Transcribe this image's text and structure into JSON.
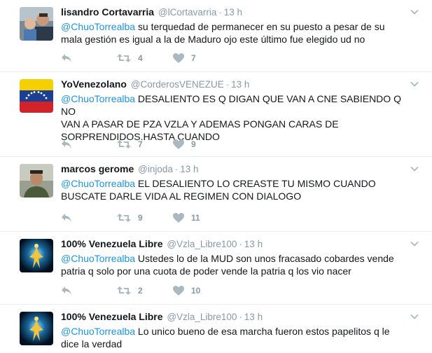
{
  "tweets": [
    {
      "fullname": "lisandro Cortavarria",
      "username": "@lCortavarria",
      "time": "13 h",
      "mention": "@ChuoTorrealba",
      "text": " su terquedad de permanecer en su puesto a pesar de su\nmala gestión es igual a la de Maduro ojo este último fue elegido ud no",
      "retweets": "4",
      "likes": "7",
      "avatar": "man-with-child-photo"
    },
    {
      "fullname": "YoVenezolano",
      "username": "@CorderosVENEZUE",
      "time": "13 h",
      "mention": "@ChuoTorrealba",
      "text": " DESALIENTO ES Q DIGAN QUE VAN A CNE SABIENDO Q NO\nVAN A PASAR DE PZA VZLA Y ADEMAS PONGAN CARAS DE\nSORPRENDIDOS.HASTA CUANDO",
      "retweets": "7",
      "likes": "9",
      "avatar": "venezuela-flag"
    },
    {
      "fullname": "marcos gerome",
      "username": "@injoda",
      "time": "13 h",
      "mention": "@ChuoTorrealba",
      "text": " EL DESALIENTO LO CREASTE TU MISMO CUANDO\nBUSCATE  DARLE VIDA AL REGIMEN CON  DIALOGO",
      "retweets": "9",
      "likes": "11",
      "avatar": "man-portrait-photo"
    },
    {
      "fullname": "100% Venezuela Libre",
      "username": "@Vzla_Libre100",
      "time": "13 h",
      "mention": "@ChuoTorrealba",
      "text": " Ustedes lo de la MUD son unos fracasado cobardes vende\npatria q solo por una cuota de poder vende la patria q los vio nacer",
      "retweets": "2",
      "likes": "10",
      "avatar": "glowing-figure-image"
    },
    {
      "fullname": "100% Venezuela Libre",
      "username": "@Vzla_Libre100",
      "time": "13 h",
      "mention": "@ChuoTorrealba",
      "text": " Lo unico bueno de esa marcha fueron estos papelitos q le\ndice la verdad",
      "retweets": "",
      "likes": "",
      "avatar": "glowing-figure-image"
    }
  ],
  "colors": {
    "link": "#1b95e0",
    "muted": "#8899a6",
    "icon": "#aab8c2",
    "divider": "#e6ecf0"
  },
  "icons": [
    "reply-icon",
    "retweet-icon",
    "like-icon",
    "caret-down-icon"
  ]
}
